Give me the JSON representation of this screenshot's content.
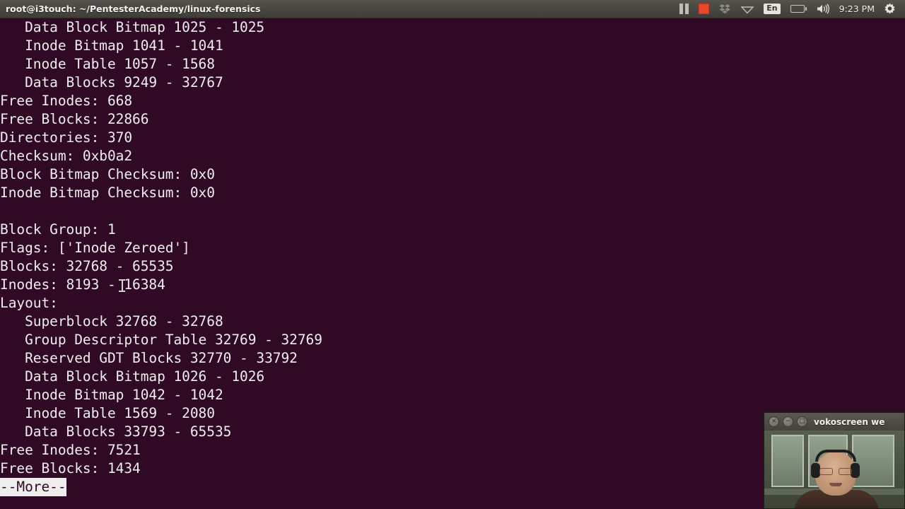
{
  "window": {
    "title": "root@i3touch: ~/PentesterAcademy/linux-forensics"
  },
  "tray": {
    "pause_icon": "pause-icon",
    "stop_icon": "record-stop-icon",
    "dropbox_icon": "dropbox-icon",
    "wifi_icon": "wifi-icon",
    "keyboard_layout": "En",
    "battery_icon": "battery-low-icon",
    "volume_icon": "volume-icon",
    "clock": "9:23 PM",
    "gear_icon": "gear-icon"
  },
  "terminal": {
    "background_color": "#300a24",
    "foreground_color": "#eeeeec",
    "lines": [
      "   Data Block Bitmap 1025 - 1025",
      "   Inode Bitmap 1041 - 1041",
      "   Inode Table 1057 - 1568",
      "   Data Blocks 9249 - 32767",
      "Free Inodes: 668",
      "Free Blocks: 22866",
      "Directories: 370",
      "Checksum: 0xb0a2",
      "Block Bitmap Checksum: 0x0",
      "Inode Bitmap Checksum: 0x0",
      "",
      "Block Group: 1",
      "Flags: ['Inode Zeroed']",
      "Blocks: 32768 - 65535",
      "Inodes: 8193 - 16384",
      "Layout:",
      "   Superblock 32768 - 32768",
      "   Group Descriptor Table 32769 - 32769",
      "   Reserved GDT Blocks 32770 - 33792",
      "   Data Block Bitmap 1026 - 1026",
      "   Inode Bitmap 1042 - 1042",
      "   Inode Table 1569 - 2080",
      "   Data Blocks 33793 - 65535",
      "Free Inodes: 7521",
      "Free Blocks: 1434"
    ],
    "more_prompt": "--More--"
  },
  "webcam": {
    "title": "vokoscreen we",
    "close_glyph": "×",
    "minimize_glyph": "−",
    "maximize_glyph": "□"
  }
}
